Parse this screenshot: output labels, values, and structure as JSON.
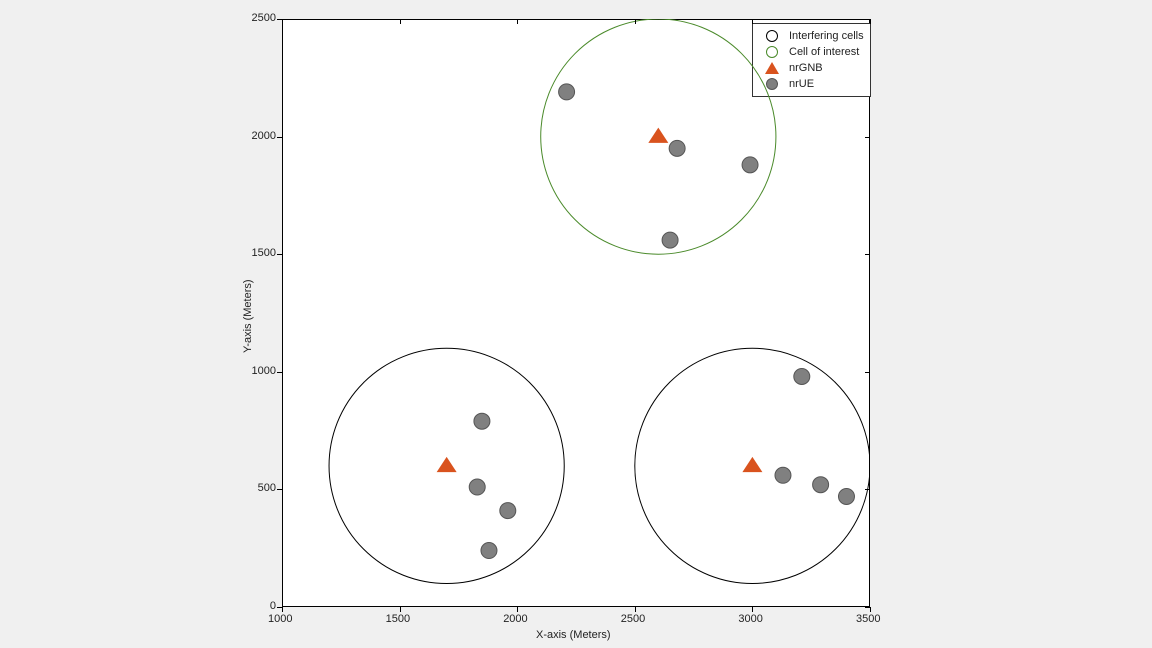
{
  "chart_data": {
    "type": "scatter",
    "xlabel": "X-axis (Meters)",
    "ylabel": "Y-axis (Meters)",
    "xlim": [
      1000,
      3500
    ],
    "ylim": [
      0,
      2500
    ],
    "xticks": [
      1000,
      1500,
      2000,
      2500,
      3000,
      3500
    ],
    "yticks": [
      0,
      500,
      1000,
      1500,
      2000,
      2500
    ],
    "xtick_labels": [
      "1000",
      "1500",
      "2000",
      "2500",
      "3000",
      "3500"
    ],
    "ytick_labels": [
      "0",
      "500",
      "1000",
      "1500",
      "2000",
      "2500"
    ],
    "cells": {
      "interfering": [
        {
          "cx": 1700,
          "cy": 600,
          "r": 500
        },
        {
          "cx": 3000,
          "cy": 600,
          "r": 500
        }
      ],
      "interest": [
        {
          "cx": 2600,
          "cy": 2000,
          "r": 500
        }
      ]
    },
    "gnb": [
      {
        "x": 1700,
        "y": 600
      },
      {
        "x": 3000,
        "y": 600
      },
      {
        "x": 2600,
        "y": 2000
      }
    ],
    "ue": [
      {
        "x": 1850,
        "y": 790
      },
      {
        "x": 1830,
        "y": 510
      },
      {
        "x": 1960,
        "y": 410
      },
      {
        "x": 1880,
        "y": 240
      },
      {
        "x": 3210,
        "y": 980
      },
      {
        "x": 3130,
        "y": 560
      },
      {
        "x": 3290,
        "y": 520
      },
      {
        "x": 3400,
        "y": 470
      },
      {
        "x": 2210,
        "y": 2190
      },
      {
        "x": 2680,
        "y": 1950
      },
      {
        "x": 2990,
        "y": 1880
      },
      {
        "x": 2650,
        "y": 1560
      }
    ],
    "legend": {
      "interfering": "Interfering cells",
      "interest": "Cell of interest",
      "gnb": "nrGNB",
      "ue": "nrUE"
    },
    "colors": {
      "interfering_stroke": "#000000",
      "interest_stroke": "#4a8a2a",
      "gnb_fill": "#d9531e",
      "ue_fill": "#808080",
      "ue_stroke": "#555555"
    }
  },
  "layout": {
    "axes_left": 282,
    "axes_top": 19,
    "axes_width": 588,
    "axes_height": 588
  }
}
